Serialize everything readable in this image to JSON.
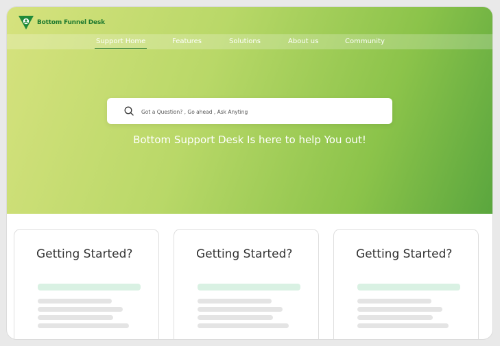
{
  "brand": {
    "name": "Bottom Funnel Desk",
    "color": "#2e7d32"
  },
  "nav": {
    "items": [
      {
        "label": "Support Home",
        "active": true
      },
      {
        "label": "Features",
        "active": false
      },
      {
        "label": "Solutions",
        "active": false
      },
      {
        "label": "About us",
        "active": false
      },
      {
        "label": "Community",
        "active": false
      }
    ]
  },
  "search": {
    "placeholder": "Got a Question? , Go ahead , Ask Anyting",
    "icon": "search-icon"
  },
  "hero": {
    "tagline": "Bottom Support Desk Is here to help You out!"
  },
  "cards": [
    {
      "title": "Getting Started?"
    },
    {
      "title": "Getting Started?"
    },
    {
      "title": "Getting Started?"
    }
  ],
  "colors": {
    "gradient_start": "#d6e27e",
    "gradient_end": "#5aa63e",
    "skeleton_accent": "#d9f1e3",
    "skeleton": "#e4e4e4"
  }
}
